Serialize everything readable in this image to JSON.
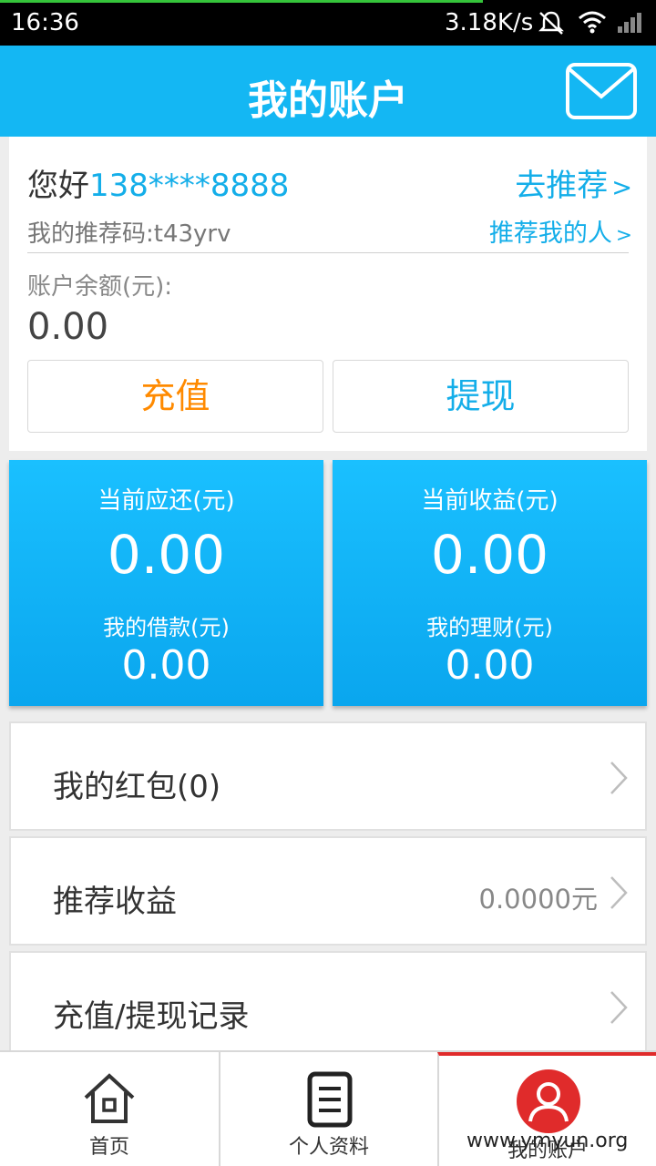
{
  "status": {
    "time": "16:36",
    "speed": "3.18K/s"
  },
  "header": {
    "title": "我的账户"
  },
  "account": {
    "greeting": "您好",
    "phone": "138****8888",
    "recommend_link": "去推荐",
    "ref_code": "我的推荐码:t43yrv",
    "my_referrer_link": "推荐我的人",
    "balance_label": "账户余额(元):",
    "balance": "0.00",
    "recharge_label": "充值",
    "withdraw_label": "提现"
  },
  "cards": [
    {
      "label1": "当前应还(元)",
      "value1": "0.00",
      "label2": "我的借款(元)",
      "value2": "0.00"
    },
    {
      "label1": "当前收益(元)",
      "value1": "0.00",
      "label2": "我的理财(元)",
      "value2": "0.00"
    }
  ],
  "menu": [
    {
      "label": "我的红包(0)",
      "value": ""
    },
    {
      "label": "推荐收益",
      "value": "0.0000元"
    },
    {
      "label": "充值/提现记录",
      "value": ""
    }
  ],
  "tabs": [
    {
      "label": "首页",
      "icon": "home-icon"
    },
    {
      "label": "个人资料",
      "icon": "document-icon"
    },
    {
      "label": "我的账户",
      "icon": "user-icon",
      "active": true
    }
  ],
  "watermark": "www.ymyun.org",
  "colors": {
    "primary": "#14b7f3",
    "accent_orange": "#ff8a00",
    "active_tab": "#e02b2b"
  }
}
